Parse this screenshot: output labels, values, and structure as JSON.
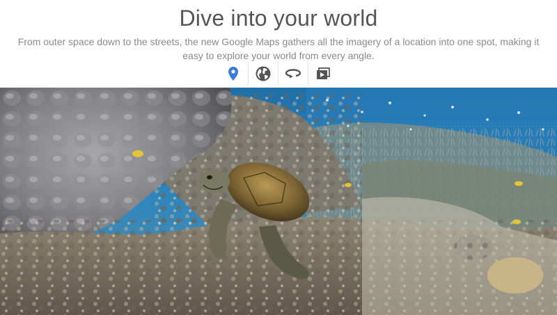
{
  "section": {
    "title": "Dive into your world",
    "subtitle": "From outer space down to the streets, the new Google Maps gathers all the imagery of a location into one spot, making it easy to explore your world from every angle."
  },
  "icons": [
    {
      "name": "map-pin-icon",
      "color": "#3b7ddd",
      "active": true
    },
    {
      "name": "globe-icon",
      "color": "#555555",
      "active": false
    },
    {
      "name": "rotate-360-icon",
      "color": "#555555",
      "active": false
    },
    {
      "name": "photo-gallery-icon",
      "color": "#555555",
      "active": false
    }
  ],
  "colors": {
    "title": "#555555",
    "subtitle": "#8a8a8a",
    "accent": "#3b7ddd",
    "water": "#1f6fa8"
  }
}
